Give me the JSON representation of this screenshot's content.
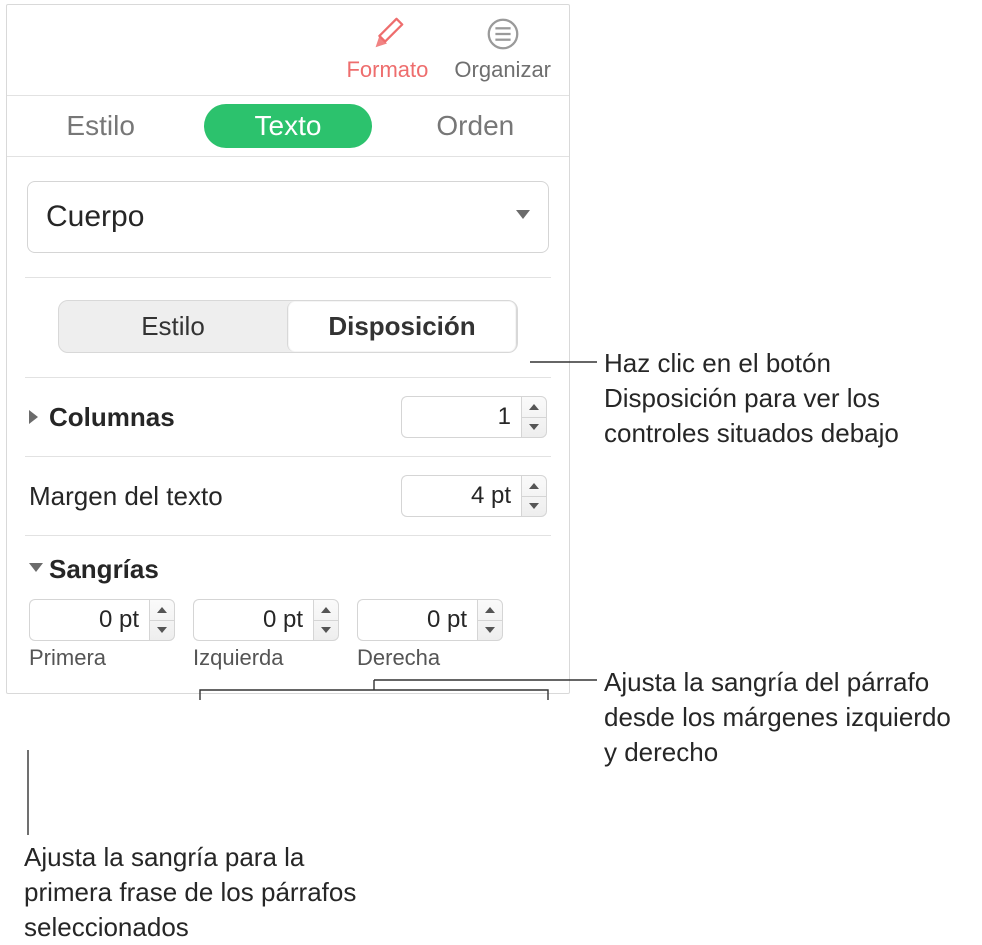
{
  "toolbar": {
    "format_label": "Formato",
    "organize_label": "Organizar"
  },
  "tabs": {
    "style": "Estilo",
    "text": "Texto",
    "order": "Orden"
  },
  "paragraph_style": {
    "selected": "Cuerpo"
  },
  "segmented": {
    "style": "Estilo",
    "layout": "Disposición"
  },
  "columns": {
    "label": "Columnas",
    "value": "1"
  },
  "text_margin": {
    "label": "Margen del texto",
    "value": "4 pt"
  },
  "indents": {
    "label": "Sangrías",
    "first": {
      "value": "0 pt",
      "caption": "Primera"
    },
    "left": {
      "value": "0 pt",
      "caption": "Izquierda"
    },
    "right": {
      "value": "0 pt",
      "caption": "Derecha"
    }
  },
  "callouts": {
    "layout_btn": "Haz clic en el botón Disposición para ver los controles situados debajo",
    "lr_indent": "Ajusta la sangría del párrafo desde los márgenes izquierdo y derecho",
    "first_indent": "Ajusta la sangría para la primera frase de los párrafos seleccionados"
  }
}
